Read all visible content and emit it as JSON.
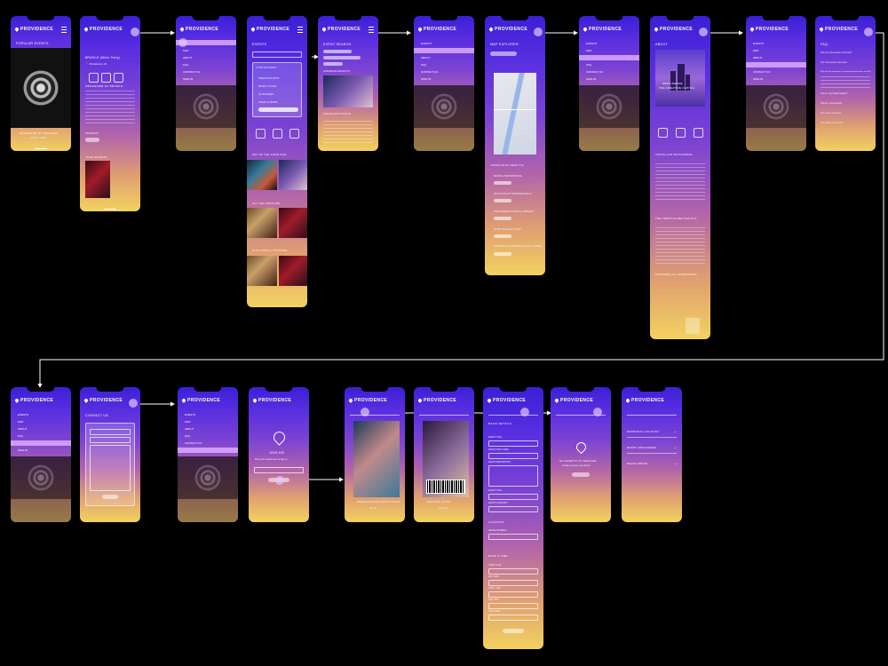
{
  "app": {
    "logo": "PROVIDENCE"
  },
  "screens": {
    "s1": {
      "section": "POPULAR EVENTS",
      "caption": "HAPPEE BD FT. PRIVNEM",
      "sub": "Jul 12 • Dusk"
    },
    "s2": {
      "event": "BRUNCH (White Party)",
      "organizer": "ORGANIZER OF BRUNCH",
      "promo": "PROMOS",
      "more": "YOUR EVENTS"
    },
    "s3": {
      "menu": [
        "EVENTS",
        "MAP",
        "ABOUT",
        "FAQ",
        "CONTACT US",
        "SIGN IN"
      ]
    },
    "s4": {
      "title": "EVENTS",
      "filter": "TYPE OF EVENT",
      "options": [
        "CREATIVE ARTS",
        "MUSIC & FILM",
        "OUTDOORS",
        "FOOD & DRINK",
        "NIGHTLIFE"
      ],
      "icons": [
        "CALENDAR",
        "LOCATION",
        "SAVE"
      ],
      "sec1": "GET OF THE FOOD FAIR",
      "sec2": "ALL THE LIBATIONS",
      "sec3": "PLUS POINT LOCATIONS"
    },
    "s5": {
      "title": "EVENT SEARCH",
      "tags": [
        "EXCLUSIVE EVENTS",
        "DOWNTOWN PROVIDENCE",
        "HOUSEBEAT"
      ],
      "results": "AUDIENCE RESULTS",
      "phone": "(Oberlin) 401-555-0123"
    },
    "s7": {
      "title": "MAP EXPLORER",
      "locate": "LOCATE ME",
      "nearby": "THINGS TO DO NEAR YOU",
      "places": [
        "BASSIC PROVIDENCE",
        "ROOFTOP AT PROVIDENCE G",
        "PROVIDENCE PUBLIC LIBRARY",
        "DOWN BALLET SHOP",
        "PROVIDENCE PERFORMING ARTS CENTER"
      ]
    },
    "s9": {
      "title": "ABOUT",
      "hero": "PROVIDENCE",
      "hero2": "THE CREATIVE CAPITAL",
      "icons": [
        "EVENTS",
        "CREATE",
        "EXPERIENCE"
      ],
      "vision": "VISION FOR PROVIDENCE",
      "melting": "THE CREATIVE MELTING POT",
      "powering": "POWERING ALL EXPERIENCE"
    },
    "s11": {
      "title": "FAQ",
      "q": [
        "How can I list events on this site?",
        "Can I list events on the site?",
        "Why has the importance of supporting local music and art?",
        "How do I get started quickly?",
        "How do I get involved?",
        "Can I leave a review?",
        "Can I share my events?"
      ]
    },
    "s13": {
      "title": "CONTACT US"
    },
    "s16": {
      "title": "JOIN US!",
      "sub": "Enter your email to save & sign up",
      "cta": "SIGN IN"
    },
    "s17": {
      "caption": "SENDA BLACK DANCE & DANCE IN THE MIX",
      "sub": "Jul 20"
    },
    "s18": {
      "caption": "HOUSE MUSIC LIVE 2022",
      "sub": "Aug 04"
    },
    "s19": {
      "title": "BASIC DETAILS",
      "fields": [
        "EVENT TITLE",
        "EVENT HOST NAME",
        "EVENT DESCRIPTION",
        "EVENT TYPE",
        "EVENT CATEGORY"
      ],
      "loc": "LOCATION",
      "addr": "VENUE ADDRESS",
      "dt": "DATE & TIME",
      "dtf": [
        "START DATE",
        "END DATE",
        "START TIME",
        "END TIME",
        "TIME ZONE"
      ],
      "cta": "NEXT"
    },
    "s20": {
      "title": "NO EVENTS TO MANAGE",
      "sub": "Create an event to get started",
      "cta": "CREATE"
    },
    "s21": {
      "rows": [
        "PERSONAL ACCOUNT",
        "EVENT ORGANIZER",
        "DEVELOPERS"
      ]
    }
  }
}
